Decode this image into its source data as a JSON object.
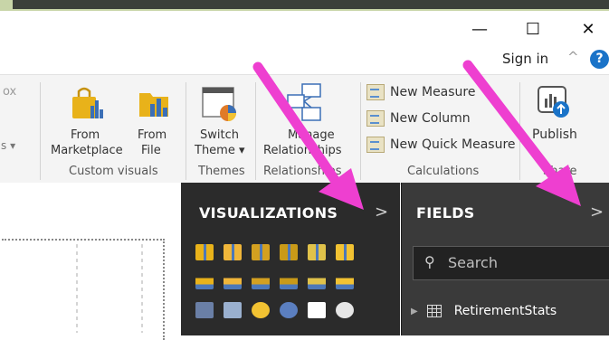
{
  "window": {
    "minimize_glyph": "—",
    "maximize_glyph": "☐",
    "close_glyph": "✕"
  },
  "account": {
    "sign_in": "Sign in",
    "collapse_glyph": "^",
    "help_glyph": "?"
  },
  "ribbon": {
    "partial_left_text": "ox",
    "partial_left_dropdown": "s ▾",
    "from_marketplace": {
      "line1": "From",
      "line2": "Marketplace"
    },
    "from_file": {
      "line1": "From",
      "line2": "File"
    },
    "switch_theme": {
      "line1": "Switch",
      "line2": "Theme ▾"
    },
    "manage_relationships": {
      "line1": "Manage",
      "line2": "Relationships"
    },
    "new_measure": "New Measure",
    "new_column": "New Column",
    "new_quick_measure": "New Quick Measure",
    "publish": "Publish",
    "groups": {
      "custom_visuals": "Custom visuals",
      "themes": "Themes",
      "relationships": "Relationships",
      "calculations": "Calculations",
      "share": "Share"
    }
  },
  "visualizations": {
    "title": "VISUALIZATIONS",
    "expand_glyph": ">"
  },
  "fields": {
    "title": "FIELDS",
    "expand_glyph": ">",
    "search_placeholder": "Search",
    "tables": [
      {
        "name": "RetirementStats"
      }
    ]
  },
  "colors": {
    "arrow": "#ee3fd0",
    "pane_dark": "#2b2b2b",
    "fields_dark": "#3a3a3a",
    "accent_blue": "#1a73c8"
  },
  "viz_icons": [
    "stacked-bar-icon",
    "stacked-column-icon",
    "clustered-bar-icon",
    "clustered-column-icon",
    "100-stacked-bar-icon",
    "100-stacked-column-icon",
    "line-chart-icon",
    "area-chart-icon",
    "stacked-area-icon",
    "line-clustered-column-icon",
    "line-stacked-column-icon",
    "ribbon-chart-icon",
    "waterfall-icon",
    "scatter-icon",
    "pie-icon",
    "donut-icon",
    "treemap-icon",
    "map-icon"
  ]
}
